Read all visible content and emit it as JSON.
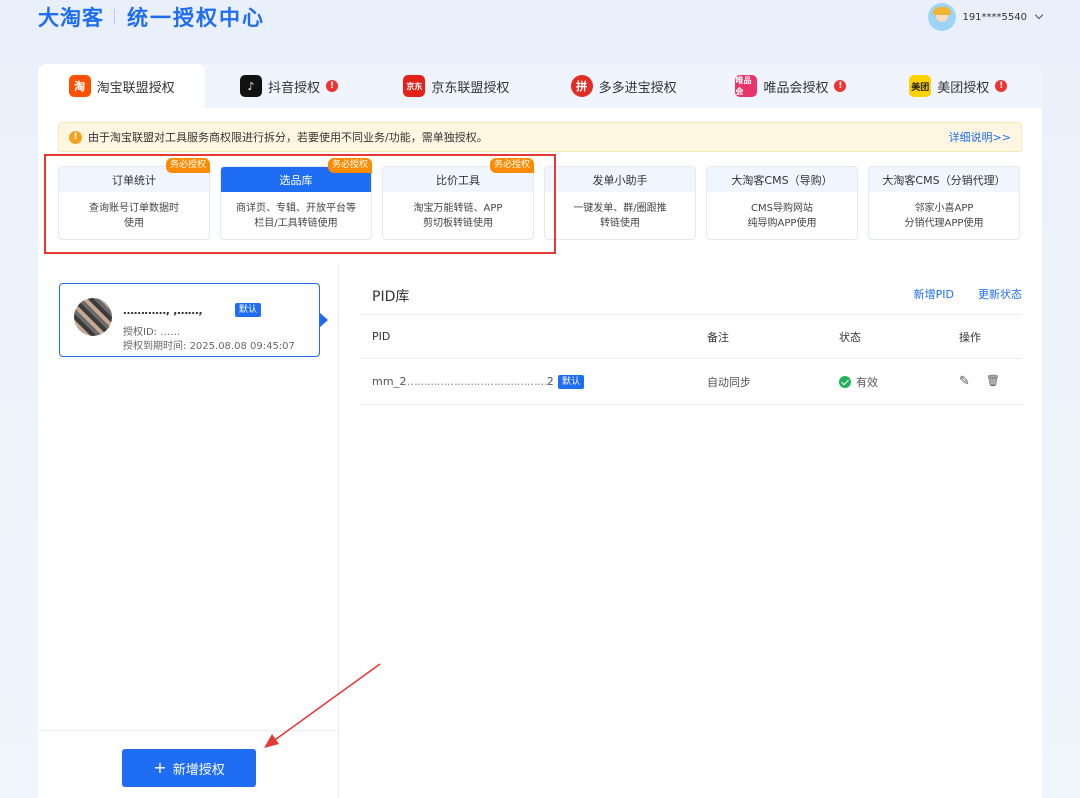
{
  "header": {
    "logo": "大淘客",
    "title": "统一授权中心",
    "user_phone": "191****5540"
  },
  "tabs": [
    {
      "label": "淘宝联盟授权",
      "icon": "taobao-icon",
      "icon_text": "淘",
      "warn": false,
      "active": true
    },
    {
      "label": "抖音授权",
      "icon": "douyin-icon",
      "icon_text": "♪",
      "warn": true,
      "active": false
    },
    {
      "label": "京东联盟授权",
      "icon": "jd-icon",
      "icon_text": "京东",
      "warn": false,
      "active": false
    },
    {
      "label": "多多进宝授权",
      "icon": "pinduoduo-icon",
      "icon_text": "拼",
      "warn": false,
      "active": false
    },
    {
      "label": "唯品会授权",
      "icon": "vipshop-icon",
      "icon_text": "唯品会",
      "warn": true,
      "active": false
    },
    {
      "label": "美团授权",
      "icon": "meituan-icon",
      "icon_text": "美团",
      "warn": true,
      "active": false
    }
  ],
  "warn_mark": "!",
  "notice": {
    "icon_text": "!",
    "text": "由于淘宝联盟对工具服务商权限进行拆分，若要使用不同业务/功能，需单独授权。",
    "link": "详细说明>>"
  },
  "feature_cards": [
    {
      "title": "订单统计",
      "desc1": "查询账号订单数据时",
      "desc2": "使用",
      "badge": "务必授权",
      "active": false
    },
    {
      "title": "选品库",
      "desc1": "商详页、专辑、开放平台等",
      "desc2": "栏目/工具转链使用",
      "badge": "务必授权",
      "active": true
    },
    {
      "title": "比价工具",
      "desc1": "淘宝万能转链、APP",
      "desc2": "剪切板转链使用",
      "badge": "务必授权",
      "active": false
    },
    {
      "title": "发单小助手",
      "desc1": "一键发单、群/圈跟推",
      "desc2": "转链使用",
      "badge": "",
      "active": false
    },
    {
      "title": "大淘客CMS（导购）",
      "desc1": "CMS导购网站",
      "desc2": "纯导购APP使用",
      "badge": "",
      "active": false
    },
    {
      "title": "大淘客CMS（分销代理）",
      "desc1": "邻家小喜APP",
      "desc2": "分销代理APP使用",
      "badge": "",
      "active": false
    }
  ],
  "account": {
    "name": "…………, ,……,",
    "default_tag": "默认",
    "id_label": "授权ID: ",
    "id_value": "……",
    "expire_label": "授权到期时间: ",
    "expire_value": "2025.08.08 09:45:07"
  },
  "add_button": {
    "plus": "+",
    "label": "新增授权"
  },
  "pid": {
    "title": "PID库",
    "add_label": "新增PID",
    "refresh_label": "更新状态",
    "columns": {
      "pid": "PID",
      "note": "备注",
      "status": "状态",
      "op": "操作"
    },
    "rows": [
      {
        "pid_prefix": "mm_2",
        "pid_masked": "……………………………………",
        "pid_suffix": "2",
        "tag": "默认",
        "note": "自动同步",
        "status": "有效"
      }
    ],
    "edit_icon": "✎",
    "delete_icon": "🗑"
  }
}
